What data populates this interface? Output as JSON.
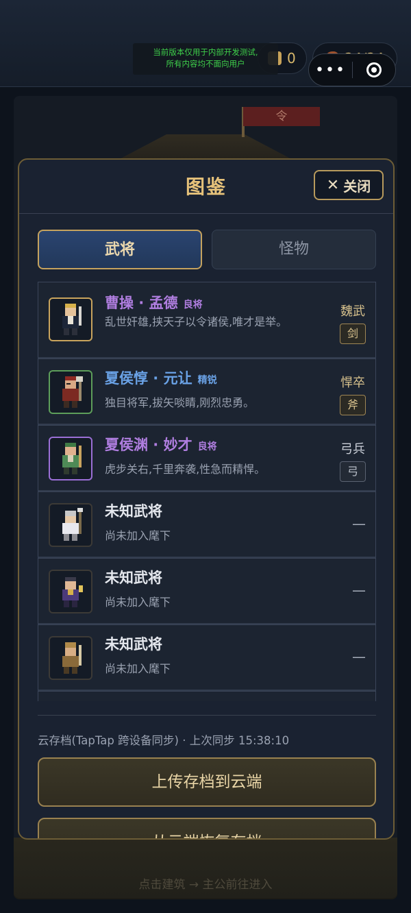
{
  "status": {
    "dev_notice_line1": "当前版本仅用于内部开发测试,",
    "dev_notice_line2": "所有内容均不面向用户",
    "coins": "0",
    "stamina": "24/24",
    "more_label": "•••"
  },
  "background": {
    "banner": "令",
    "hint": "点击建筑 → 主公前往进入"
  },
  "modal": {
    "title": "图鉴",
    "close_label": "关闭",
    "tabs": [
      {
        "label": "武将",
        "active": true
      },
      {
        "label": "怪物",
        "active": false
      }
    ],
    "entries": [
      {
        "name": "曹操 · 孟德",
        "rank": "良将",
        "desc": "乱世奸雄,挟天子以令诸侯,唯才是举。",
        "faction": "魏武",
        "weapon": "剑",
        "frame": "gold",
        "unlocked": true
      },
      {
        "name": "夏侯惇 · 元让",
        "rank": "精锐",
        "desc": "独目将军,拔矢啖睛,刚烈忠勇。",
        "faction": "悍卒",
        "weapon": "斧",
        "frame": "green",
        "unlocked": true
      },
      {
        "name": "夏侯渊 · 妙才",
        "rank": "良将",
        "desc": "虎步关右,千里奔袭,性急而精悍。",
        "faction": "弓兵",
        "weapon": "弓",
        "frame": "purple",
        "unlocked": true
      },
      {
        "name": "未知武将",
        "desc": "尚未加入麾下",
        "placeholder": "—",
        "unlocked": false
      },
      {
        "name": "未知武将",
        "desc": "尚未加入麾下",
        "placeholder": "—",
        "unlocked": false
      },
      {
        "name": "未知武将",
        "desc": "尚未加入麾下",
        "placeholder": "—",
        "unlocked": false
      }
    ],
    "cloud_status": "云存档(TapTap 跨设备同步) · 上次同步 15:38:10",
    "upload_label": "上传存档到云端",
    "restore_label": "从云端恢复存档"
  },
  "colors": {
    "accent_gold": "#e6c27a",
    "rank_purple": "#b07ee0",
    "rank_blue": "#6aa2e6",
    "dev_green": "#3fd04b"
  }
}
